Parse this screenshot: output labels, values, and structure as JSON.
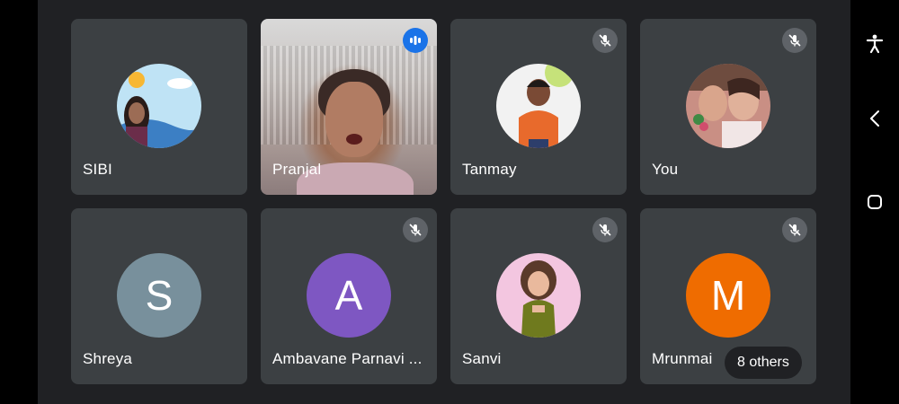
{
  "participants": [
    {
      "name": "SIBI",
      "status": "none"
    },
    {
      "name": "Pranjal",
      "status": "speaking"
    },
    {
      "name": "Tanmay",
      "status": "muted"
    },
    {
      "name": "You",
      "status": "muted"
    },
    {
      "name": "Shreya",
      "status": "none",
      "initial": "S",
      "color": "#78909c"
    },
    {
      "name": "Ambavane  Parnavi ...",
      "status": "muted",
      "initial": "A",
      "color": "#7e57c2"
    },
    {
      "name": "Sanvi",
      "status": "muted"
    },
    {
      "name": "Mrunmai",
      "status": "muted",
      "initial": "M",
      "color": "#ef6c00"
    }
  ],
  "others_label": "8 others",
  "colors": {
    "stage_bg": "#202124",
    "tile_bg": "#3c4043",
    "mute_badge": "#5f6368",
    "speaking_badge": "#1a73e8"
  },
  "icons": {
    "mute": "mic-off-icon",
    "speaking": "audio-level-icon",
    "accessibility": "accessibility-icon",
    "back": "back-chevron-icon",
    "home": "home-square-icon"
  }
}
